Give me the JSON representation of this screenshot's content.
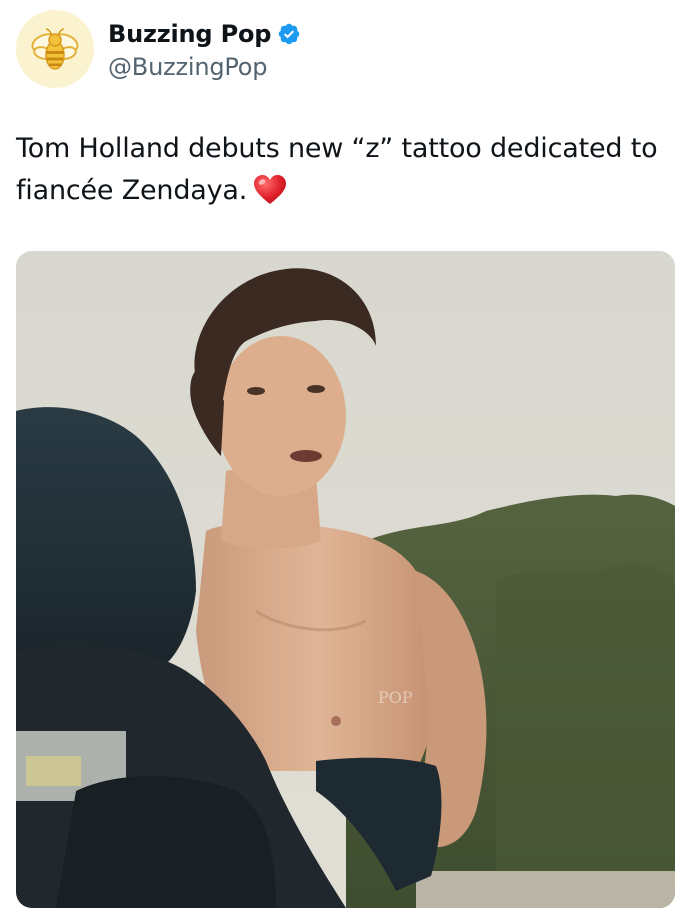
{
  "author": {
    "display_name": "Buzzing Pop",
    "handle": "@BuzzingPop",
    "verified": true,
    "avatar_icon": "bee-icon",
    "verified_icon": "verified-badge-icon"
  },
  "tweet": {
    "text_line1": "Tom Holland debuts new “z” tattoo dedicated to",
    "text_line2": "fiancée Zendaya.",
    "emoji": "red-heart-icon"
  },
  "media": {
    "watermark": "POP"
  },
  "colors": {
    "text": "#0f1419",
    "secondary": "#536471",
    "verified": "#1d9bf0",
    "avatar_bg": "#fbf3cf",
    "bee_yellow": "#f3c23a"
  }
}
